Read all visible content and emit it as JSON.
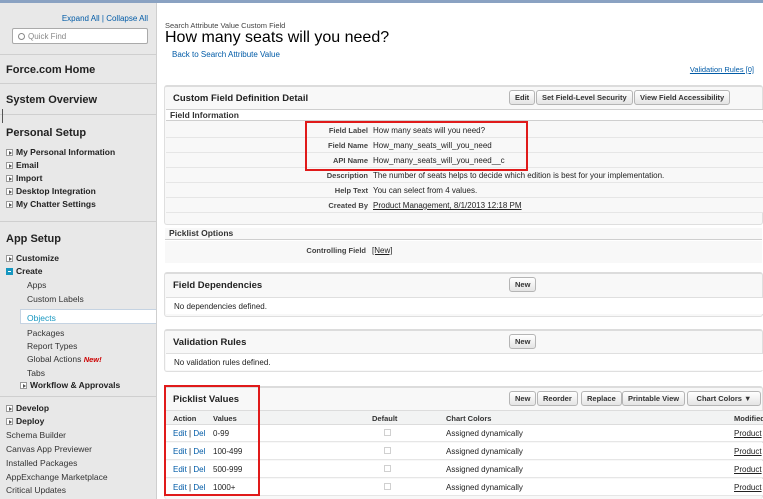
{
  "sidebar": {
    "expand_all": "Expand All",
    "separator": "|",
    "collapse_all": "Collapse All",
    "search_placeholder": "Quick Find",
    "force_home": "Force.com Home",
    "system_overview": "System Overview",
    "personal_setup": "Personal Setup",
    "personal_items": [
      "My Personal Information",
      "Email",
      "Import",
      "Desktop Integration",
      "My Chatter Settings"
    ],
    "app_setup": "App Setup",
    "customize": "Customize",
    "create": "Create",
    "create_items": [
      "Apps",
      "Custom Labels",
      "Objects",
      "Packages",
      "Report Types",
      "Global Actions",
      "Tabs"
    ],
    "new_badge": "New!",
    "workflow": "Workflow & Approvals",
    "develop": "Develop",
    "deploy": "Deploy",
    "plain_items": [
      "Schema Builder",
      "Canvas App Previewer",
      "Installed Packages",
      "AppExchange Marketplace",
      "Critical Updates"
    ]
  },
  "header": {
    "breadcrumb": "Search Attribute Value Custom Field",
    "title": "How many seats will you need?",
    "back_link": "Back to Search Attribute Value",
    "validation_rules_link": "Validation Rules [0]"
  },
  "detail": {
    "heading": "Custom Field Definition Detail",
    "buttons": [
      "Edit",
      "Set Field-Level Security",
      "View Field Accessibility"
    ],
    "field_info_heading": "Field Information",
    "fields": [
      {
        "label": "Field Label",
        "value": "How many seats will you need?"
      },
      {
        "label": "Field Name",
        "value": "How_many_seats_will_you_need"
      },
      {
        "label": "API Name",
        "value": "How_many_seats_will_you_need__c"
      },
      {
        "label": "Description",
        "value": "The number of seats helps to decide which edition is best for your implementation."
      },
      {
        "label": "Help Text",
        "value": "You can select from 4 values."
      },
      {
        "label": "Created By",
        "value": "Product Management, 8/1/2013 12:18 PM"
      }
    ],
    "picklist_options_heading": "Picklist Options",
    "controlling_field_label": "Controlling Field",
    "controlling_field_value": "[New]"
  },
  "dependencies": {
    "heading": "Field Dependencies",
    "new_button": "New",
    "empty_text": "No dependencies defined."
  },
  "validation": {
    "heading": "Validation Rules",
    "new_button": "New",
    "empty_text": "No validation rules defined."
  },
  "picklist": {
    "heading": "Picklist Values",
    "buttons": [
      "New",
      "Reorder",
      "Replace",
      "Printable View"
    ],
    "chart_colors_button": "Chart Colors ▼",
    "columns": [
      "Action",
      "Values",
      "Default",
      "Chart Colors",
      "Modified"
    ],
    "edit_label": "Edit",
    "action_sep": "|",
    "del_label": "Del",
    "rows": [
      {
        "value": "0-99",
        "chart_color": "Assigned dynamically",
        "modified": "Product"
      },
      {
        "value": "100-499",
        "chart_color": "Assigned dynamically",
        "modified": "Product"
      },
      {
        "value": "500-999",
        "chart_color": "Assigned dynamically",
        "modified": "Product"
      },
      {
        "value": "1000+",
        "chart_color": "Assigned dynamically",
        "modified": "Product"
      }
    ]
  },
  "colors": {
    "link": "#015ba7",
    "highlight": "#e01a1a",
    "selected_nav": "#1797c0"
  }
}
